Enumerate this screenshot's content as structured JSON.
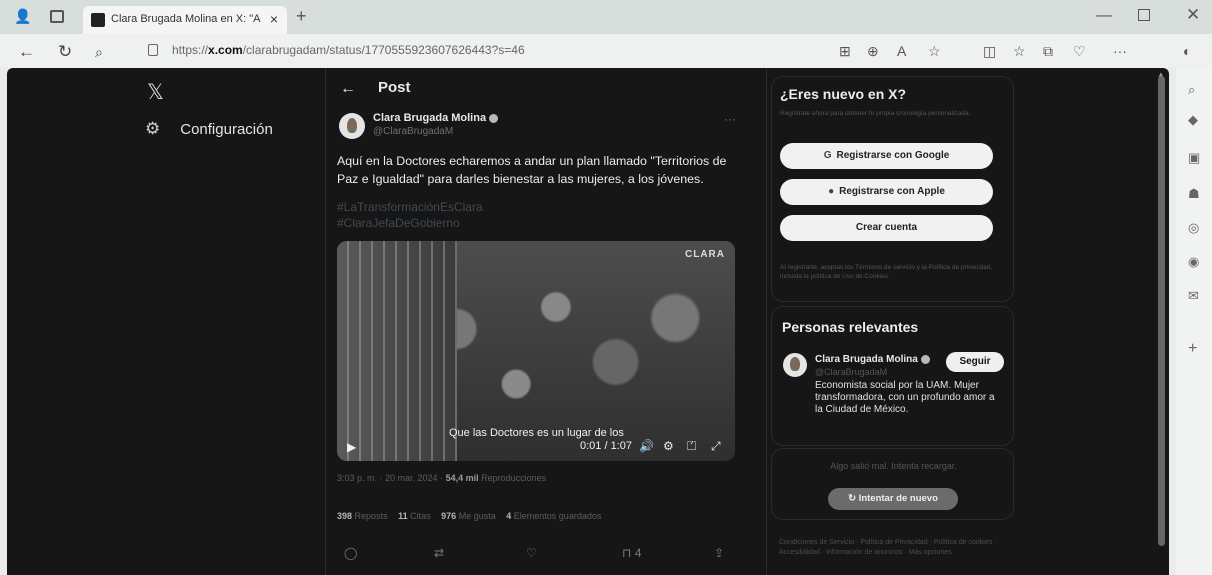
{
  "browser": {
    "tab_title": "Clara Brugada Molina en X: \"Aquí",
    "tab_close": "×",
    "new_tab": "+",
    "url_prefix": "https://",
    "url_domain": "x.com",
    "url_path": "/clarabrugadam/status/1770555923607626443?s=46",
    "icons": [
      "back-icon",
      "refresh-icon",
      "search-icon",
      "lock-icon",
      "grid-icon",
      "zoom-icon",
      "read-aloud-icon",
      "favorite-icon",
      "split-icon",
      "favorites-icon",
      "collections-icon",
      "heart-icon",
      "more-icon",
      "copilot-icon"
    ]
  },
  "left": {
    "logo": "𝕏",
    "settings_label": "Configuración"
  },
  "post": {
    "header": "Post",
    "author_name": "Clara Brugada Molina",
    "author_handle": "@ClaraBrugadaM",
    "more": "···",
    "text": "Aquí en la Doctores echaremos a andar un plan llamado \"Territorios de Paz e Igualdad\" para darles bienestar a las mujeres, a los jóvenes.",
    "hashtag1": "#LaTransformaciónEsClara",
    "hashtag2": "#ClaraJefaDeGobierno",
    "video": {
      "brand": "CLARA",
      "caption": "Que las Doctores es un lugar de los",
      "time": "0:01 / 1:07"
    },
    "time_date": "3:03 p. m. · 20 mar. 2024 ·",
    "views_count": "54,4 mil",
    "views_label": "Reproducciones",
    "reposts_count": "398",
    "reposts_label": "Reposts",
    "quotes_count": "11",
    "quotes_label": "Citas",
    "likes_count": "976",
    "likes_label": "Me gusta",
    "saves_count": "4",
    "saves_label": "Elementos guardados",
    "bookmark_count": "4"
  },
  "signup": {
    "title": "¿Eres nuevo en X?",
    "subtitle": "Regístrate ahora para obtener tu propia cronología personalizada.",
    "google": "Registrarse con Google",
    "apple": "Registrarse con Apple",
    "create": "Crear cuenta",
    "legal": "Al registrarte, aceptas los Términos de servicio y la Política de privacidad, incluida la política de Uso de Cookies."
  },
  "relevant": {
    "title": "Personas relevantes",
    "name": "Clara Brugada Molina",
    "handle": "@ClaraBrugadaM",
    "follow": "Seguir",
    "bio": "Economista social por la UAM. Mujer transformadora, con un profundo amor a la Ciudad de México."
  },
  "error": {
    "message": "Algo salió mal. Intenta recargar.",
    "retry": "Intentar de nuevo"
  },
  "footer": "Condiciones de Servicio · Política de Privacidad · Política de cookies · Accesibilidad · Información de anuncios · Más opciones"
}
